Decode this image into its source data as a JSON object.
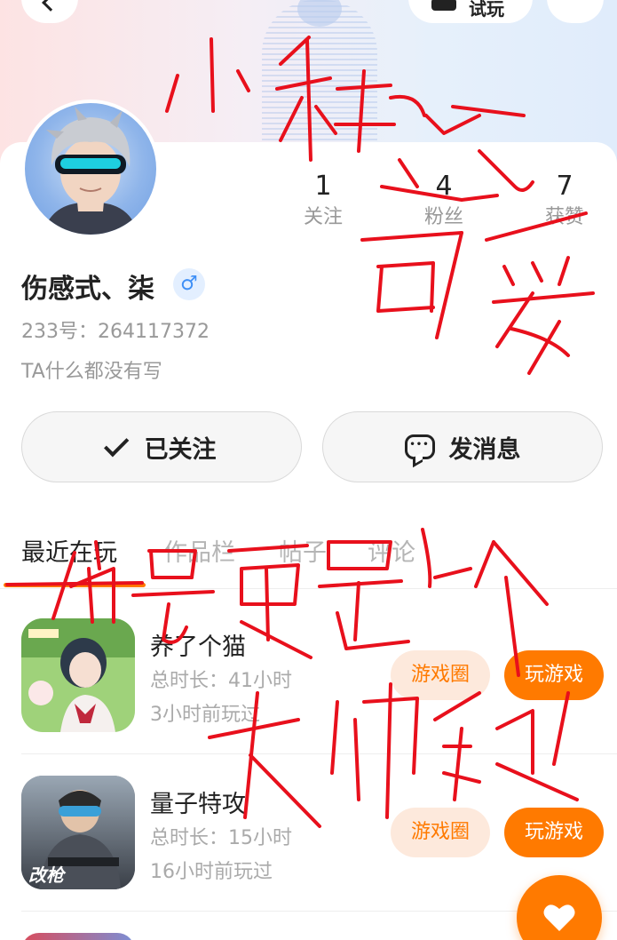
{
  "header": {
    "pill_label": "试玩"
  },
  "profile": {
    "nickname": "伤感式、柒",
    "gender_symbol": "♂",
    "uid": "233号：264117372",
    "bio": "TA什么都没有写",
    "stats": [
      {
        "value": "1",
        "label": "关注"
      },
      {
        "value": "4",
        "label": "粉丝"
      },
      {
        "value": "7",
        "label": "获赞"
      }
    ]
  },
  "actions": {
    "follow_label": "已关注",
    "message_label": "发消息",
    "bubble_dots": "•••"
  },
  "tabs": [
    {
      "label": "最近在玩",
      "active": true
    },
    {
      "label": "作品栏",
      "active": false
    },
    {
      "label": "帖子",
      "active": false
    },
    {
      "label": "评论",
      "active": false
    }
  ],
  "games": [
    {
      "name": "养了个猫",
      "duration": "总时长：41小时",
      "last_played": "3小时前玩过",
      "circle_label": "游戏圈",
      "play_label": "玩游戏"
    },
    {
      "name": "量子特攻",
      "duration": "总时长：15小时",
      "last_played": "16小时前玩过",
      "icon_badge": "改枪",
      "circle_label": "游戏圈",
      "play_label": "玩游戏"
    }
  ],
  "colors": {
    "accent": "#ff7a00",
    "accent_light": "#fde9dc",
    "doodle": "#e8101c"
  }
}
